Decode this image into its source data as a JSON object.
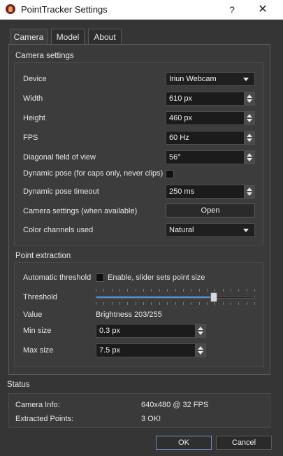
{
  "window": {
    "title": "PointTracker Settings",
    "help": "?",
    "close": "✕"
  },
  "tabs": [
    {
      "label": "Camera",
      "active": true
    },
    {
      "label": "Model",
      "active": false
    },
    {
      "label": "About",
      "active": false
    }
  ],
  "camera_settings": {
    "title": "Camera settings",
    "device": {
      "label": "Device",
      "value": "Iriun Webcam"
    },
    "width": {
      "label": "Width",
      "value": "610 px"
    },
    "height": {
      "label": "Height",
      "value": "460 px"
    },
    "fps": {
      "label": "FPS",
      "value": "60 Hz"
    },
    "dfov": {
      "label": "Diagonal field of view",
      "value": "56°"
    },
    "dynamic_pose": {
      "label": "Dynamic pose (for caps only, never clips)",
      "checked": false
    },
    "dynamic_pose_timeout": {
      "label": "Dynamic pose timeout",
      "value": "250 ms"
    },
    "camera_settings_btn": {
      "label": "Camera settings (when available)",
      "button": "Open"
    },
    "color_channels": {
      "label": "Color channels used",
      "value": "Natural"
    }
  },
  "point_extraction": {
    "title": "Point extraction",
    "auto_threshold": {
      "label": "Automatic threshold",
      "checkbox_label": "Enable, slider sets point size",
      "checked": false
    },
    "threshold": {
      "label": "Threshold",
      "level": 0.74
    },
    "value": {
      "label": "Value",
      "text": "Brightness 203/255"
    },
    "min_size": {
      "label": "Min size",
      "value": "0.3 px"
    },
    "max_size": {
      "label": "Max size",
      "value": "7.5 px"
    }
  },
  "status": {
    "title": "Status",
    "camera_info": {
      "label": "Camera Info:",
      "value": "640x480 @ 32 FPS"
    },
    "extracted_points": {
      "label": "Extracted Points:",
      "value": "3 OK!"
    }
  },
  "buttons": {
    "ok": "OK",
    "cancel": "Cancel"
  },
  "colors": {
    "accent": "#4a90d9",
    "background": "#353535"
  },
  "icons": {
    "app": "pointtracker-app-icon",
    "close": "close-icon",
    "help": "help-icon",
    "spin": "spin-arrows-icon",
    "dropdown": "chevron-down-icon"
  }
}
